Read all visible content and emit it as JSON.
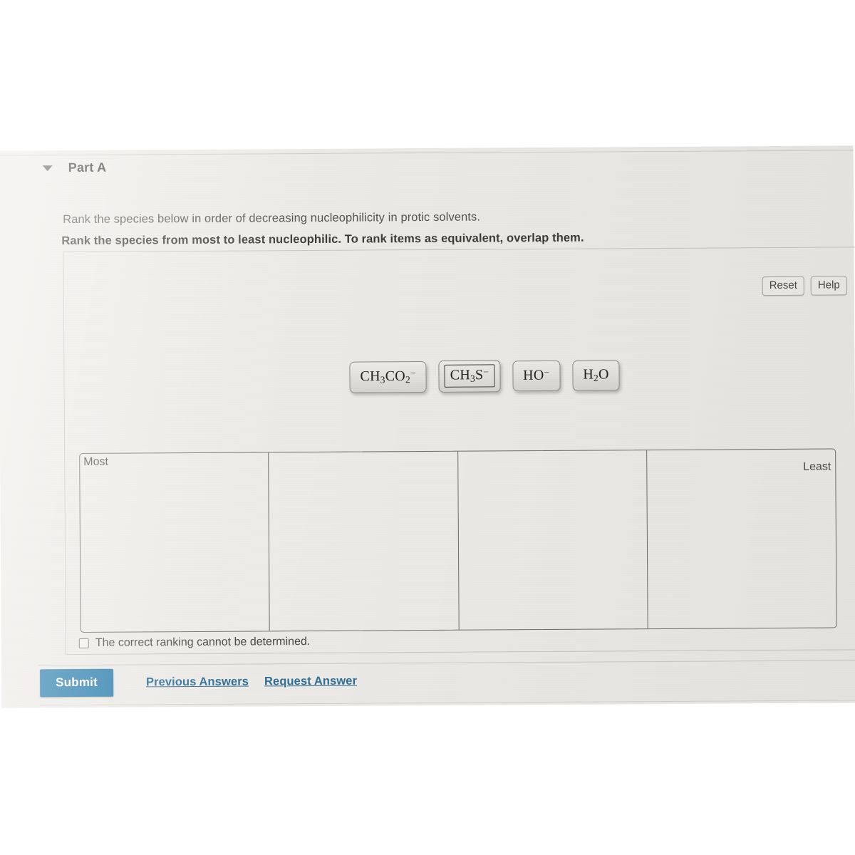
{
  "part": {
    "collapse_icon": "caret-down-icon",
    "title": "Part A"
  },
  "prompt": {
    "line1": "Rank the species below in order of decreasing nucleophilicity in protic solvents.",
    "line2": "Rank the species from most to least nucleophilic. To rank items as equivalent, overlap them."
  },
  "toolbar": {
    "reset_label": "Reset",
    "help_label": "Help"
  },
  "species": [
    {
      "id": "acetate",
      "base": "CH",
      "sub1": "3",
      "mid": "CO",
      "sub2": "2",
      "charge": "−",
      "selected": false,
      "plain": "CH3CO2-"
    },
    {
      "id": "thiolate",
      "base": "CH",
      "sub1": "3",
      "mid": "S",
      "sub2": "",
      "charge": "−",
      "selected": true,
      "plain": "CH3S-"
    },
    {
      "id": "hydroxide",
      "base": "HO",
      "sub1": "",
      "mid": "",
      "sub2": "",
      "charge": "−",
      "selected": false,
      "plain": "HO-"
    },
    {
      "id": "water",
      "base": "H",
      "sub1": "2",
      "mid": "O",
      "sub2": "",
      "charge": "",
      "selected": false,
      "plain": "H2O"
    }
  ],
  "ranking": {
    "most_label": "Most",
    "least_label": "Least",
    "bins": [
      "",
      "",
      "",
      ""
    ],
    "bin_count": 4
  },
  "cannot_determine": {
    "label": "The correct ranking cannot be determined.",
    "checked": false
  },
  "actions": {
    "submit_label": "Submit",
    "previous_answers_label": "Previous Answers",
    "request_answer_label": "Request Answer"
  },
  "colors": {
    "submit_blue": "#2d7fae",
    "link_blue": "#2f6f96",
    "screen_bg": "#eceae6",
    "border_gray": "#6e6d6c"
  }
}
